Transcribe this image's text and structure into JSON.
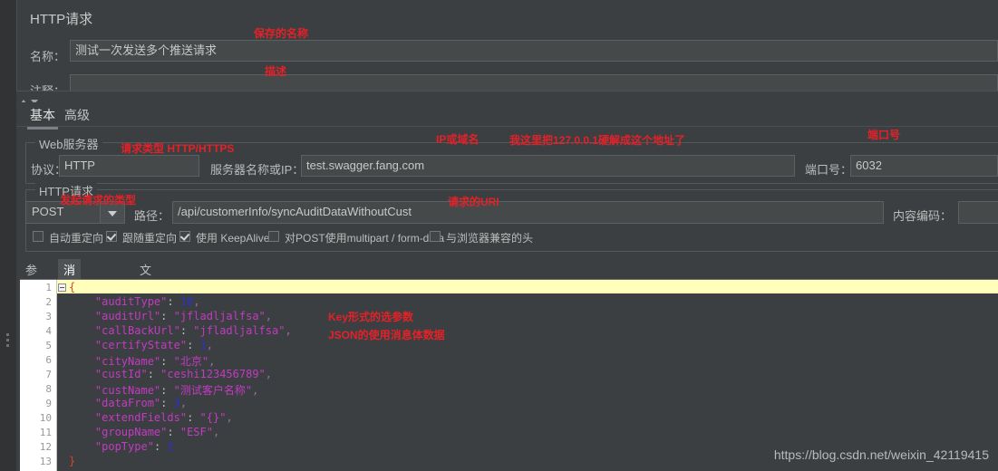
{
  "panel": {
    "title": "HTTP请求",
    "name_label": "名称：",
    "name_value": "测试一次发送多个推送请求",
    "comment_label": "注释：",
    "comment_value": ""
  },
  "main_tabs": [
    {
      "label": "基本",
      "active": true
    },
    {
      "label": "高级",
      "active": false
    }
  ],
  "web_server": {
    "legend": "Web服务器",
    "protocol_label": "协议：",
    "protocol_value": "HTTP",
    "server_label": "服务器名称或IP：",
    "server_value": "test.swagger.fang.com",
    "port_label": "端口号：",
    "port_value": "6032"
  },
  "http_request": {
    "legend": "HTTP请求",
    "method_value": "POST",
    "path_label": "路径：",
    "path_value": "/api/customerInfo/syncAuditDataWithoutCust",
    "encoding_label": "内容编码：",
    "encoding_value": "",
    "checkboxes": [
      {
        "label": "自动重定向",
        "checked": false
      },
      {
        "label": "跟随重定向",
        "checked": true
      },
      {
        "label": "使用 KeepAlive",
        "checked": true
      },
      {
        "label": "对POST使用multipart / form-data",
        "checked": false
      },
      {
        "label": "与浏览器兼容的头",
        "checked": false
      }
    ]
  },
  "sub_tabs": [
    {
      "label": "参数",
      "active": false
    },
    {
      "label": "消息体数据",
      "active": true
    },
    {
      "label": "文件上传",
      "active": false
    }
  ],
  "editor": {
    "line_numbers": [
      "1",
      "2",
      "3",
      "4",
      "5",
      "6",
      "7",
      "8",
      "9",
      "10",
      "11",
      "12",
      "13"
    ],
    "lines": [
      {
        "n": 1,
        "text": "{"
      },
      {
        "n": 2,
        "text": "    \"auditType\": 16,"
      },
      {
        "n": 3,
        "text": "    \"auditUrl\": \"jfladljalfsa\","
      },
      {
        "n": 4,
        "text": "    \"callBackUrl\": \"jfladljalfsa\","
      },
      {
        "n": 5,
        "text": "    \"certifyState\": 1,"
      },
      {
        "n": 6,
        "text": "    \"cityName\": \"北京\","
      },
      {
        "n": 7,
        "text": "    \"custId\": \"ceshi123456789\","
      },
      {
        "n": 8,
        "text": "    \"custName\": \"测试客户名称\","
      },
      {
        "n": 9,
        "text": "    \"dataFrom\": 3,"
      },
      {
        "n": 10,
        "text": "    \"extendFields\": \"{}\","
      },
      {
        "n": 11,
        "text": "    \"groupName\": \"ESF\","
      },
      {
        "n": 12,
        "text": "    \"popType\": 2"
      },
      {
        "n": 13,
        "text": "}"
      }
    ],
    "json_body": {
      "auditType": 16,
      "auditUrl": "jfladljalfsa",
      "callBackUrl": "jfladljalfsa",
      "certifyState": 1,
      "cityName": "北京",
      "custId": "ceshi123456789",
      "custName": "测试客户名称",
      "dataFrom": 3,
      "extendFields": "{}",
      "groupName": "ESF",
      "popType": 2
    }
  },
  "annotations": {
    "saved_name": "保存的名称",
    "description": "描述",
    "request_type": "请求类型 HTTP/HTTPS",
    "ip_or_domain": "IP或域名",
    "host_note": "我这里把127.0.0.1硬解成这个地址了",
    "port_note": "端口号",
    "method_note": "发起请求的类型",
    "uri_note": "请求的URI",
    "key_params": "Key形式的选参数",
    "json_body": "JSON的使用消息体数据"
  },
  "watermark": "https://blog.csdn.net/weixin_42119415",
  "colors": {
    "annotation_red": "#e32128",
    "panel_bg": "#3c3f41",
    "input_bg": "#45494a",
    "current_line": "#ffffbb",
    "json_string": "#c23bc2",
    "json_number": "#2d2dd8",
    "json_brace": "#d9432f"
  }
}
